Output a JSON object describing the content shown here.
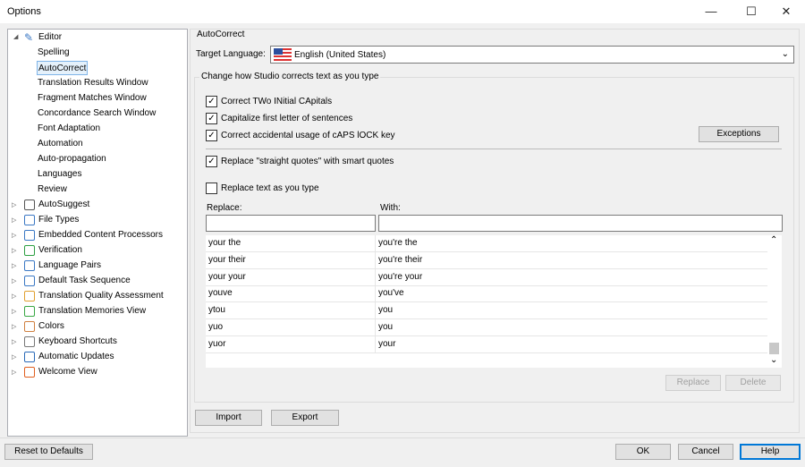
{
  "window": {
    "title": "Options",
    "minimize": "—",
    "maximize": "☐",
    "close": "✕"
  },
  "tree": {
    "editor": {
      "label": "Editor",
      "children": [
        "Spelling",
        "AutoCorrect",
        "Translation Results Window",
        "Fragment Matches Window",
        "Concordance Search Window",
        "Font Adaptation",
        "Automation",
        "Auto-propagation",
        "Languages",
        "Review"
      ]
    },
    "items": [
      {
        "label": "AutoSuggest",
        "icon": "autosuggest-icon",
        "color": "#555555"
      },
      {
        "label": "File Types",
        "icon": "file-types-icon",
        "color": "#3b78c4"
      },
      {
        "label": "Embedded Content Processors",
        "icon": "embedded-content-icon",
        "color": "#3b78c4"
      },
      {
        "label": "Verification",
        "icon": "verification-icon",
        "color": "#2ea043"
      },
      {
        "label": "Language Pairs",
        "icon": "language-pairs-icon",
        "color": "#3b78c4"
      },
      {
        "label": "Default Task Sequence",
        "icon": "task-sequence-icon",
        "color": "#3b78c4"
      },
      {
        "label": "Translation Quality Assessment",
        "icon": "tqa-icon",
        "color": "#e0a030"
      },
      {
        "label": "Translation Memories View",
        "icon": "tm-view-icon",
        "color": "#3aa845"
      },
      {
        "label": "Colors",
        "icon": "colors-icon",
        "color": "#d08040"
      },
      {
        "label": "Keyboard Shortcuts",
        "icon": "keyboard-icon",
        "color": "#777777"
      },
      {
        "label": "Automatic Updates",
        "icon": "updates-icon",
        "color": "#2a6ab8"
      },
      {
        "label": "Welcome View",
        "icon": "home-icon",
        "color": "#e06020"
      }
    ]
  },
  "autocorrect": {
    "section_title": "AutoCorrect",
    "target_language_label": "Target Language:",
    "target_language": "English (United States)",
    "group_title": "Change how Studio corrects text as you type",
    "options": [
      {
        "label": "Correct TWo INitial CApitals",
        "checked": true
      },
      {
        "label": "Capitalize first letter of sentences",
        "checked": true
      },
      {
        "label": "Correct accidental usage of cAPS lOCK key",
        "checked": true
      },
      {
        "label": "Replace \"straight quotes\" with smart quotes",
        "checked": true
      },
      {
        "label": "Replace text as you type",
        "checked": false
      }
    ],
    "exceptions_button": "Exceptions",
    "replace_label": "Replace:",
    "with_label": "With:",
    "replace_value": "",
    "with_value": "",
    "rows": [
      {
        "replace": "your the",
        "with": "you're the"
      },
      {
        "replace": "your their",
        "with": "you're their"
      },
      {
        "replace": "your your",
        "with": "you're your"
      },
      {
        "replace": "youve",
        "with": "you've"
      },
      {
        "replace": "ytou",
        "with": "you"
      },
      {
        "replace": "yuo",
        "with": "you"
      },
      {
        "replace": "yuor",
        "with": "your"
      }
    ],
    "replace_button": "Replace",
    "delete_button": "Delete",
    "import_button": "Import",
    "export_button": "Export"
  },
  "footer": {
    "reset": "Reset to Defaults",
    "ok": "OK",
    "cancel": "Cancel",
    "help": "Help"
  }
}
